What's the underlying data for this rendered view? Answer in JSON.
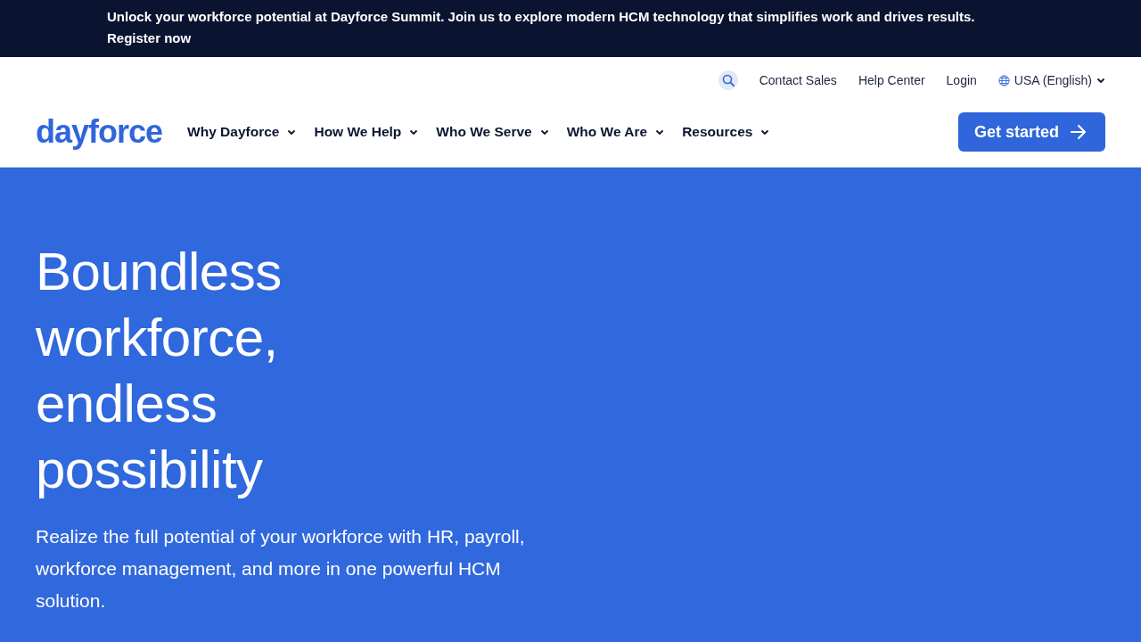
{
  "announcement": {
    "text": "Unlock your workforce potential at Dayforce Summit. Join us to explore modern HCM technology that simplifies work and drives results.",
    "link": "Register now"
  },
  "utility_nav": {
    "links": [
      "Contact Sales",
      "Help Center",
      "Login"
    ],
    "language": "USA (English)"
  },
  "logo": "dayforce",
  "main_nav": [
    {
      "label": "Why Dayforce"
    },
    {
      "label": "How We Help"
    },
    {
      "label": "Who We Serve"
    },
    {
      "label": "Who We Are"
    },
    {
      "label": "Resources"
    }
  ],
  "cta_button": "Get started",
  "hero": {
    "headline": "Boundless workforce, endless possibility",
    "subheadline": "Realize the full potential of your workforce with HR, payroll, workforce management, and more in one powerful HCM solution."
  }
}
